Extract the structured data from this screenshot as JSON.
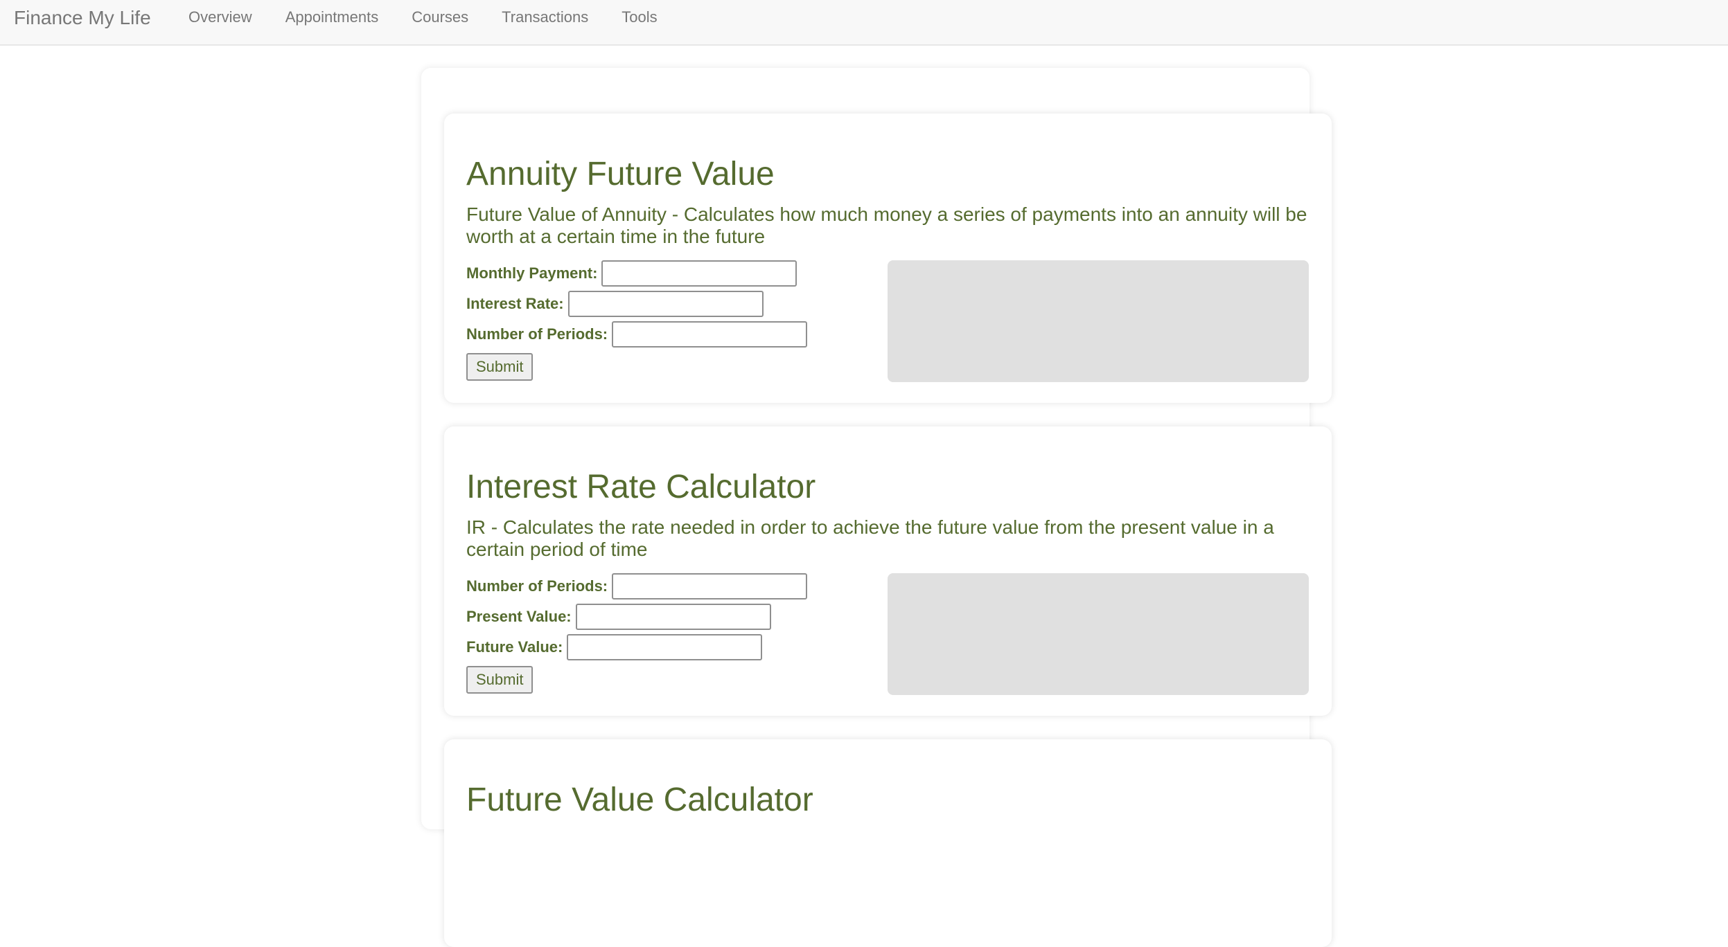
{
  "navbar": {
    "brand": "Finance My Life",
    "links": [
      "Overview",
      "Appointments",
      "Courses",
      "Transactions",
      "Tools"
    ]
  },
  "calculators": [
    {
      "title": "Annuity Future Value",
      "description": "Future Value of Annuity - Calculates how much money a series of payments into an annuity will be worth at a certain time in the future",
      "fields": [
        {
          "label": "Monthly Payment:",
          "value": ""
        },
        {
          "label": "Interest Rate:",
          "value": ""
        },
        {
          "label": "Number of Periods:",
          "value": ""
        }
      ],
      "submit_label": "Submit"
    },
    {
      "title": "Interest Rate Calculator",
      "description": "IR - Calculates the rate needed in order to achieve the future value from the present value in a certain period of time",
      "fields": [
        {
          "label": "Number of Periods:",
          "value": ""
        },
        {
          "label": "Present Value:",
          "value": ""
        },
        {
          "label": "Future Value:",
          "value": ""
        }
      ],
      "submit_label": "Submit"
    },
    {
      "title": "Future Value Calculator"
    }
  ],
  "colors": {
    "heading": "#556b2f",
    "nav_text": "#777777",
    "navbar_bg": "#f8f8f8",
    "result_bg": "#e0e0e0"
  }
}
